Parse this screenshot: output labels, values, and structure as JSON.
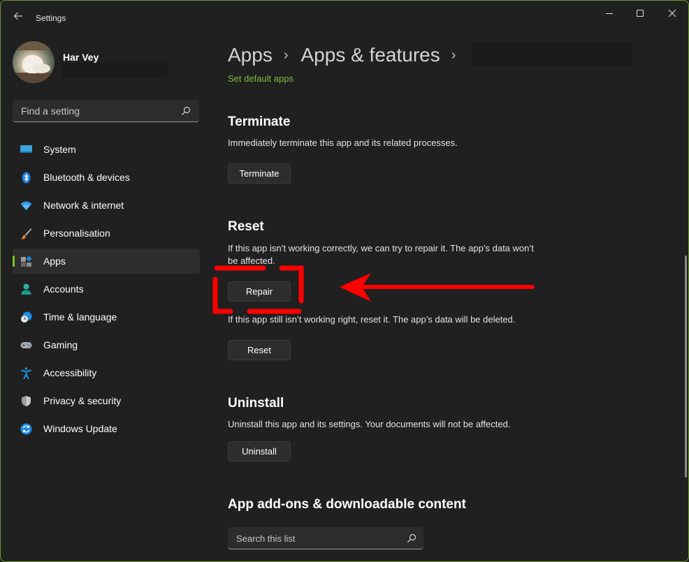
{
  "window": {
    "title": "Settings",
    "controls": {
      "minimize": "minimize",
      "maximize": "maximize",
      "close": "close"
    }
  },
  "profile": {
    "name": "Har Vey",
    "email": ""
  },
  "sidebar": {
    "search_placeholder": "Find a setting",
    "items": [
      {
        "label": "System",
        "icon": "system-icon",
        "selected": false
      },
      {
        "label": "Bluetooth & devices",
        "icon": "bluetooth-icon",
        "selected": false
      },
      {
        "label": "Network & internet",
        "icon": "wifi-icon",
        "selected": false
      },
      {
        "label": "Personalisation",
        "icon": "paintbrush-icon",
        "selected": false
      },
      {
        "label": "Apps",
        "icon": "apps-icon",
        "selected": true
      },
      {
        "label": "Accounts",
        "icon": "accounts-icon",
        "selected": false
      },
      {
        "label": "Time & language",
        "icon": "time-language-icon",
        "selected": false
      },
      {
        "label": "Gaming",
        "icon": "gamepad-icon",
        "selected": false
      },
      {
        "label": "Accessibility",
        "icon": "accessibility-icon",
        "selected": false
      },
      {
        "label": "Privacy & security",
        "icon": "shield-icon",
        "selected": false
      },
      {
        "label": "Windows Update",
        "icon": "windows-update-icon",
        "selected": false
      }
    ]
  },
  "breadcrumb": {
    "items": [
      "Apps",
      "Apps & features"
    ],
    "separator": "›",
    "current_redacted": true
  },
  "main": {
    "set_default_link": "Set default apps",
    "terminate": {
      "title": "Terminate",
      "description": "Immediately terminate this app and its related processes.",
      "button": "Terminate"
    },
    "reset": {
      "title": "Reset",
      "repair_description": "If this app isn’t working correctly, we can try to repair it. The app’s data won’t be affected.",
      "repair_button": "Repair",
      "reset_description": "If this app still isn’t working right, reset it. The app’s data will be deleted.",
      "reset_button": "Reset"
    },
    "uninstall": {
      "title": "Uninstall",
      "description": "Uninstall this app and its settings. Your documents will not be affected.",
      "button": "Uninstall"
    },
    "addons": {
      "title": "App add-ons & downloadable content",
      "search_placeholder": "Search this list"
    }
  },
  "annotation": {
    "color": "#ff0000",
    "target": "Repair"
  },
  "colors": {
    "accent": "#7cc61f",
    "link": "#7fbf3b",
    "background": "#202020",
    "window_border": "#6a9a2c"
  }
}
